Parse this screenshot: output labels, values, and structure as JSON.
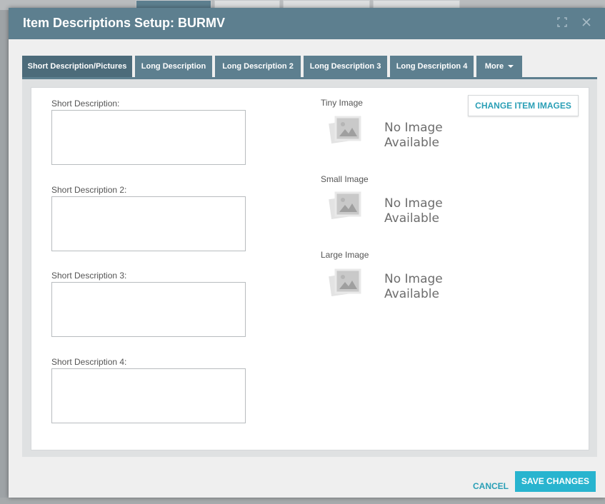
{
  "dialog": {
    "title": "Item Descriptions Setup: BURMV",
    "header_icons": [
      "expand-icon",
      "close-icon"
    ]
  },
  "tabs": [
    {
      "label": "Short Description/Pictures",
      "active": true
    },
    {
      "label": "Long Description",
      "active": false
    },
    {
      "label": "Long Description 2",
      "active": false
    },
    {
      "label": "Long Description 3",
      "active": false
    },
    {
      "label": "Long Description 4",
      "active": false
    },
    {
      "label": "More",
      "active": false,
      "dropdown": true
    }
  ],
  "fields": [
    {
      "label": "Short Description:",
      "value": ""
    },
    {
      "label": "Short Description 2:",
      "value": ""
    },
    {
      "label": "Short Description 3:",
      "value": ""
    },
    {
      "label": "Short Description 4:",
      "value": ""
    }
  ],
  "images": [
    {
      "label": "Tiny Image",
      "placeholder_line1": "No Image",
      "placeholder_line2": "Available"
    },
    {
      "label": "Small Image",
      "placeholder_line1": "No Image",
      "placeholder_line2": "Available"
    },
    {
      "label": "Large Image",
      "placeholder_line1": "No Image",
      "placeholder_line2": "Available"
    }
  ],
  "buttons": {
    "change_images": "CHANGE ITEM IMAGES",
    "cancel": "CANCEL",
    "save": "SAVE CHANGES"
  },
  "colors": {
    "header_bg": "#5d7f8f",
    "tab_bg": "#5d7f8f",
    "accent": "#28b4cf",
    "link": "#2a9fb6"
  }
}
